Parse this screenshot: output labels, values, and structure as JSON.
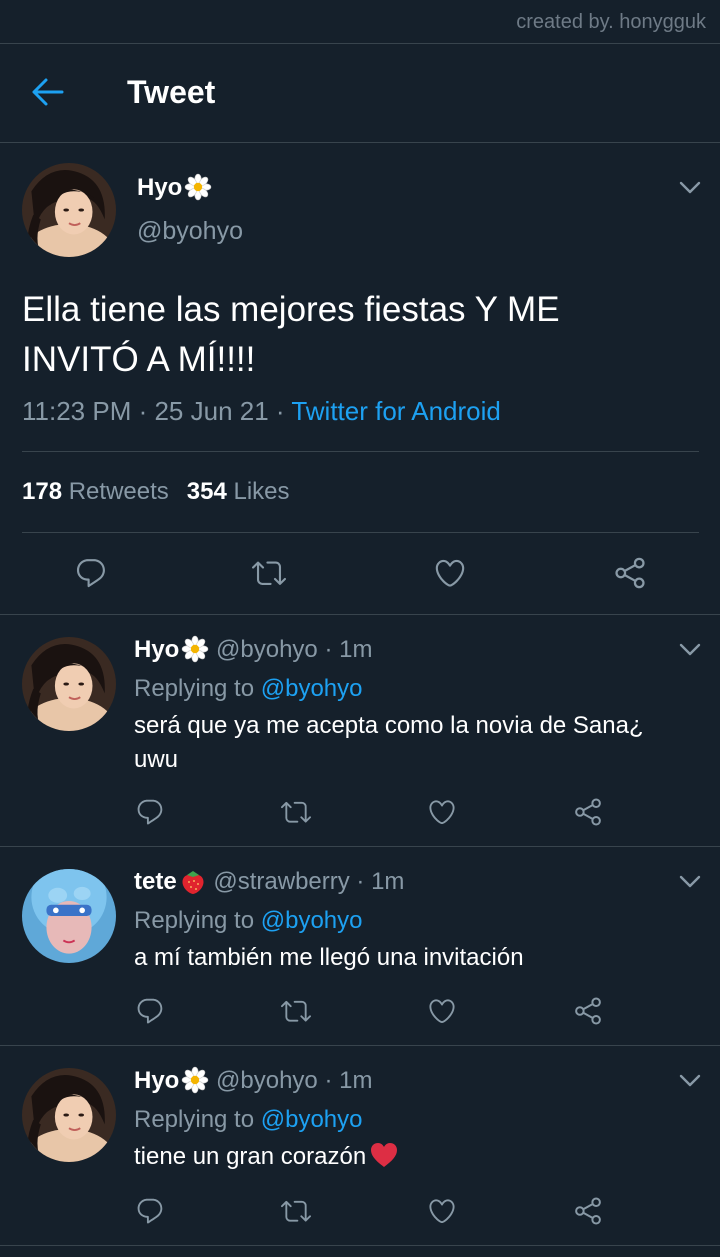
{
  "watermark": "created by. honygguk",
  "header": {
    "title": "Tweet"
  },
  "main_tweet": {
    "name": "Hyo",
    "handle": "@byohyo",
    "text": "Ella tiene las mejores fiestas Y ME INVITÓ A MÍ!!!!",
    "time": "11:23 PM · 25 Jun 21 · ",
    "source": "Twitter for Android",
    "retweets": "178",
    "retweets_label": "Retweets",
    "likes": "354",
    "likes_label": "Likes"
  },
  "replies": [
    {
      "name": "Hyo",
      "handle": "@byohyo",
      "time": "· 1m",
      "replying_prefix": "Replying to ",
      "replying_to": "@byohyo",
      "text": "será que ya me acepta como la novia de Sana¿ uwu"
    },
    {
      "name": "tete",
      "handle": "@strawberry",
      "time": "· 1m",
      "replying_prefix": "Replying to ",
      "replying_to": "@byohyo",
      "text": "a mí también me llegó una invitación"
    },
    {
      "name": "Hyo",
      "handle": "@byohyo",
      "time": "· 1m",
      "replying_prefix": "Replying to ",
      "replying_to": "@byohyo",
      "text": "tiene un gran corazón"
    }
  ],
  "colors": {
    "background": "#15202b",
    "accent": "#1da1f2",
    "secondary_text": "#8899a6",
    "divider": "#38444d"
  },
  "icons": [
    "back-arrow-icon",
    "chevron-down-icon",
    "reply-icon",
    "retweet-icon",
    "like-icon",
    "share-icon",
    "daisy-emoji",
    "strawberry-emoji",
    "red-heart-emoji"
  ]
}
